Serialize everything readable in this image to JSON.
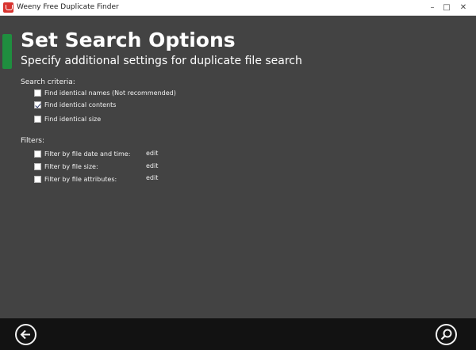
{
  "window": {
    "title": "Weeny Free Duplicate Finder",
    "controls": {
      "minimize": "–",
      "maximize": "□",
      "close": "✕"
    }
  },
  "page": {
    "heading": "Set Search Options",
    "subheading": "Specify additional settings for duplicate file search"
  },
  "search_criteria": {
    "label": "Search criteria:",
    "options": [
      {
        "label": "Find identical names (Not recommended)",
        "checked": false
      },
      {
        "label": "Find identical contents",
        "checked": true
      },
      {
        "label": "Find identical size",
        "checked": false
      }
    ]
  },
  "filters": {
    "label": "Filters:",
    "options": [
      {
        "label": "Filter by file date and time:",
        "checked": false,
        "link": "edit"
      },
      {
        "label": "Filter by file size:",
        "checked": false,
        "link": "edit"
      },
      {
        "label": "Filter by file attributes:",
        "checked": false,
        "link": "edit"
      }
    ]
  },
  "bottom_bar": {
    "back_icon": "arrow-left-icon",
    "search_icon": "magnifier-icon"
  },
  "colors": {
    "background": "#434343",
    "accent": "#1f8e3f",
    "bottom_bar": "#121212",
    "app_icon": "#d8332f"
  }
}
